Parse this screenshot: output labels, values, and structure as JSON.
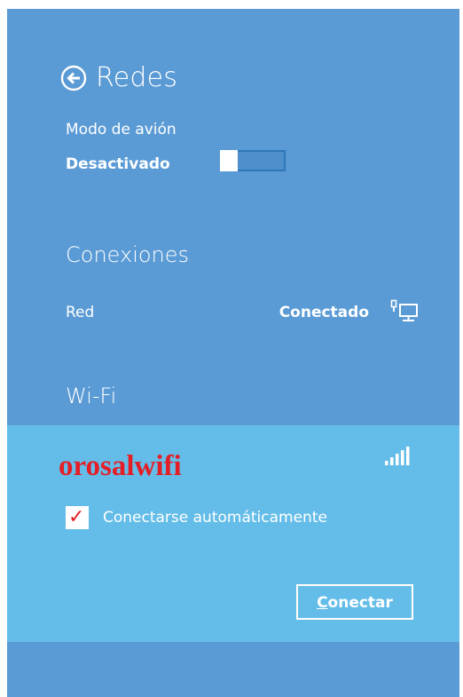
{
  "colors": {
    "panel_bg": "#5b9bd5",
    "wifi_card_bg": "#64bde8",
    "text": "#ffffff",
    "network_name": "#e41e26"
  },
  "header": {
    "title": "Redes",
    "back_icon": "back-arrow-circle-icon"
  },
  "airplane_mode": {
    "label": "Modo de avión",
    "state": "Desactivado",
    "on": false
  },
  "connections": {
    "heading": "Conexiones",
    "items": [
      {
        "name": "Red",
        "status": "Conectado",
        "icon": "ethernet-icon"
      }
    ]
  },
  "wifi": {
    "heading": "Wi-Fi",
    "networks": [
      {
        "name": "orosalwifi",
        "signal_icon": "wifi-signal-icon",
        "auto_connect_label": "Conectarse automáticamente",
        "auto_connect_checked": true,
        "connect_label": "Conectar"
      }
    ]
  }
}
